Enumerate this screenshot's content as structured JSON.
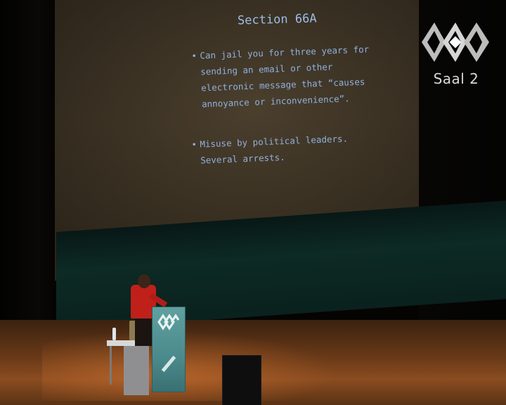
{
  "slide": {
    "title": "Section 66A",
    "bullets": [
      {
        "marker": "•",
        "lines": [
          "Can jail you for three years for",
          "sending an email or other",
          "electronic message that “causes",
          "annoyance or inconvenience”."
        ]
      },
      {
        "marker": "•",
        "lines": [
          "Misuse by political leaders.",
          "Several arrests."
        ]
      }
    ]
  },
  "overlay": {
    "hall_label": "Saal 2",
    "logo_icon": "conference-logo-icon"
  },
  "colors": {
    "slide_text": "#90b0de",
    "shirt": "#c0201a",
    "lectern": "#4b8a8c",
    "floor": "#8a4c20"
  }
}
